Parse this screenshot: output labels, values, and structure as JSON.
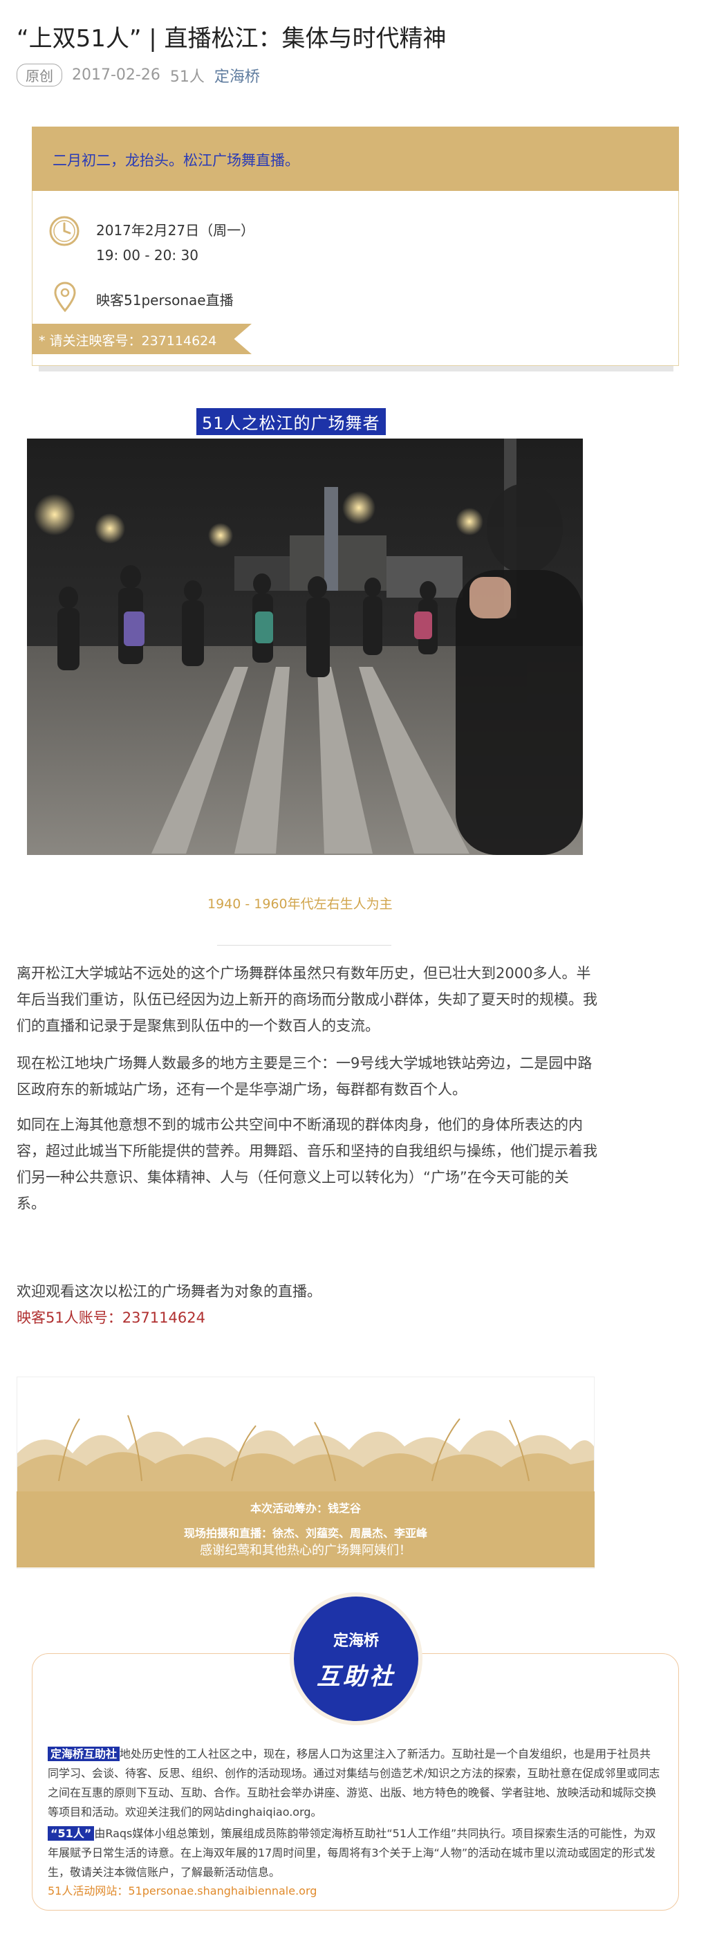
{
  "article": {
    "title": "“上双51人” | 直播松江：集体与时代精神",
    "badge": "原创",
    "date": "2017-02-26",
    "count": "51人",
    "author": "定海桥"
  },
  "event": {
    "headline": "二月初二，龙抬头。松江广场舞直播。",
    "date": "2017年2月27日（周一）",
    "time": "19: 00 - 20: 30",
    "place": "映客51personae直播",
    "ribbon": "* 请关注映客号：237114624"
  },
  "photo": {
    "title": "51人之松江的广场舞者",
    "caption": "1940 - 1960年代左右生人为主"
  },
  "body": {
    "p1": "离开松江大学城站不远处的这个广场舞群体虽然只有数年历史，但已壮大到2000多人。半年后当我们重访，队伍已经因为边上新开的商场而分散成小群体，失却了夏天时的规模。我们的直播和记录于是聚焦到队伍中的一个数百人的支流。",
    "p2": "现在松江地块广场舞人数最多的地方主要是三个：一9号线大学城地铁站旁边，二是园中路区政府东的新城站广场，还有一个是华亭湖广场，每群都有数百个人。",
    "p3": "如同在上海其他意想不到的城市公共空间中不断涌现的群体肉身，他们的身体所表达的内容，超过此城当下所能提供的营养。用舞蹈、音乐和坚持的自我组织与操练，他们提示着我们另一种公共意识、集体精神、人与（任何意义上可以转化为）“广场”在今天可能的关系。",
    "p4": "欢迎观看这次以松江的广场舞者为对象的直播。",
    "p5": "映客51人账号：237114624"
  },
  "banner": {
    "line1": "本次活动筹办：钱芝谷",
    "line2": "现场拍摄和直播：徐杰、刘蕴奕、周晨杰、李亚峰",
    "line3": "感谢纪莺和其他热心的广场舞阿姨们！"
  },
  "footer": {
    "logo_top": "定海桥",
    "logo_bottom": "互助社",
    "p1_tag": "定海桥互助社",
    "p1": "地处历史性的工人社区之中，现在，移居人口为这里注入了新活力。互助社是一个自发组织，也是用于社员共同学习、会谈、待客、反思、组织、创作的活动现场。通过对集结与创造艺术/知识之方法的探索，互助社意在促成邻里或同志之间在互惠的原则下互动、互助、合作。互助社会举办讲座、游览、出版、地方特色的晚餐、学者驻地、放映活动和城际交换等项目和活动。欢迎关注我们的网站dinghaiqiao.org。",
    "p2_tag": "“51人”",
    "p2": "由Raqs媒体小组总策划，策展组成员陈韵带领定海桥互助社“51人工作组”共同执行。项目探索生活的可能性，为双年展赋予日常生活的诗意。在上海双年展的17周时间里，每周将有3个关于上海“人物”的活动在城市里以流动或固定的形式发生，敬请关注本微信账户，了解最新活动信息。",
    "site": "51人活动网站：51personae.shanghaibiennale.org"
  },
  "colors": {
    "gold": "#d6b575",
    "blue": "#1d33a8",
    "author": "#5f7c9f",
    "orange": "#e08a2b"
  }
}
